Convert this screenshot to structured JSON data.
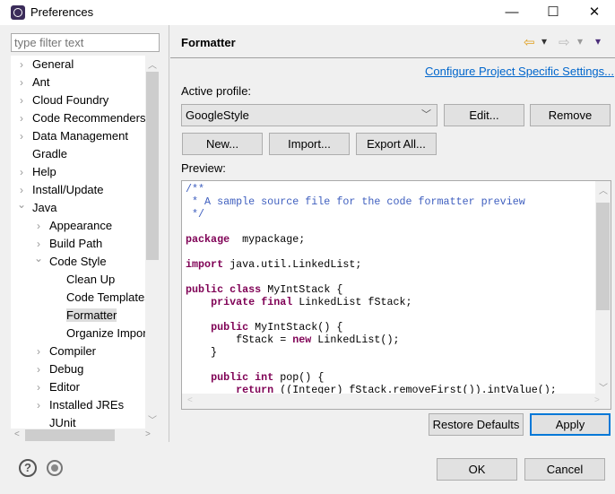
{
  "window": {
    "title": "Preferences",
    "minimize": "—",
    "maximize": "☐",
    "close": "✕"
  },
  "sidebar": {
    "filter_placeholder": "type filter text",
    "items": [
      {
        "label": "General",
        "level": 0,
        "expander": "collapsed"
      },
      {
        "label": "Ant",
        "level": 0,
        "expander": "collapsed"
      },
      {
        "label": "Cloud Foundry",
        "level": 0,
        "expander": "collapsed"
      },
      {
        "label": "Code Recommenders",
        "level": 0,
        "expander": "collapsed"
      },
      {
        "label": "Data Management",
        "level": 0,
        "expander": "collapsed"
      },
      {
        "label": "Gradle",
        "level": 0,
        "expander": "none"
      },
      {
        "label": "Help",
        "level": 0,
        "expander": "collapsed"
      },
      {
        "label": "Install/Update",
        "level": 0,
        "expander": "collapsed"
      },
      {
        "label": "Java",
        "level": 0,
        "expander": "expanded"
      },
      {
        "label": "Appearance",
        "level": 1,
        "expander": "collapsed"
      },
      {
        "label": "Build Path",
        "level": 1,
        "expander": "collapsed"
      },
      {
        "label": "Code Style",
        "level": 1,
        "expander": "expanded"
      },
      {
        "label": "Clean Up",
        "level": 2,
        "expander": "none"
      },
      {
        "label": "Code Templates",
        "level": 2,
        "expander": "none"
      },
      {
        "label": "Formatter",
        "level": 2,
        "expander": "none",
        "selected": true
      },
      {
        "label": "Organize Imports",
        "level": 2,
        "expander": "none"
      },
      {
        "label": "Compiler",
        "level": 1,
        "expander": "collapsed"
      },
      {
        "label": "Debug",
        "level": 1,
        "expander": "collapsed"
      },
      {
        "label": "Editor",
        "level": 1,
        "expander": "collapsed"
      },
      {
        "label": "Installed JREs",
        "level": 1,
        "expander": "collapsed"
      },
      {
        "label": "JUnit",
        "level": 1,
        "expander": "none"
      }
    ]
  },
  "main": {
    "title": "Formatter",
    "nav": {
      "back": "⇦",
      "forward": "⇨",
      "dropdown": "▾"
    },
    "project_link": "Configure Project Specific Settings...",
    "active_profile_label": "Active profile:",
    "profile_value": "GoogleStyle",
    "edit": "Edit...",
    "remove": "Remove",
    "new": "New...",
    "import": "Import...",
    "export_all": "Export All...",
    "preview_label": "Preview:",
    "code_lines": [
      [
        [
          "cm",
          "/**"
        ]
      ],
      [
        [
          "cm",
          " * A sample source file for the code formatter preview"
        ]
      ],
      [
        [
          "cm",
          " */"
        ]
      ],
      [],
      [
        [
          "kw",
          "package"
        ],
        [
          "",
          "  mypackage;"
        ]
      ],
      [],
      [
        [
          "kw",
          "import"
        ],
        [
          "",
          " java.util.LinkedList;"
        ]
      ],
      [],
      [
        [
          "kw",
          "public"
        ],
        [
          "",
          " "
        ],
        [
          "kw",
          "class"
        ],
        [
          "",
          " MyIntStack {"
        ]
      ],
      [
        [
          "",
          "    "
        ],
        [
          "kw",
          "private"
        ],
        [
          "",
          " "
        ],
        [
          "kw",
          "final"
        ],
        [
          "",
          " LinkedList fStack;"
        ]
      ],
      [],
      [
        [
          "",
          "    "
        ],
        [
          "kw",
          "public"
        ],
        [
          "",
          " MyIntStack() {"
        ]
      ],
      [
        [
          "",
          "        fStack = "
        ],
        [
          "kw",
          "new"
        ],
        [
          "",
          " LinkedList();"
        ]
      ],
      [
        [
          "",
          "    }"
        ]
      ],
      [],
      [
        [
          "",
          "    "
        ],
        [
          "kw",
          "public"
        ],
        [
          "",
          " "
        ],
        [
          "kw",
          "int"
        ],
        [
          "",
          " pop() {"
        ]
      ],
      [
        [
          "",
          "        "
        ],
        [
          "kw",
          "return"
        ],
        [
          "",
          " ((Integer) fStack.removeFirst()).intValue();"
        ]
      ]
    ],
    "restore_defaults": "Restore Defaults",
    "apply": "Apply"
  },
  "footer": {
    "ok": "OK",
    "cancel": "Cancel",
    "help_icon": "?"
  }
}
